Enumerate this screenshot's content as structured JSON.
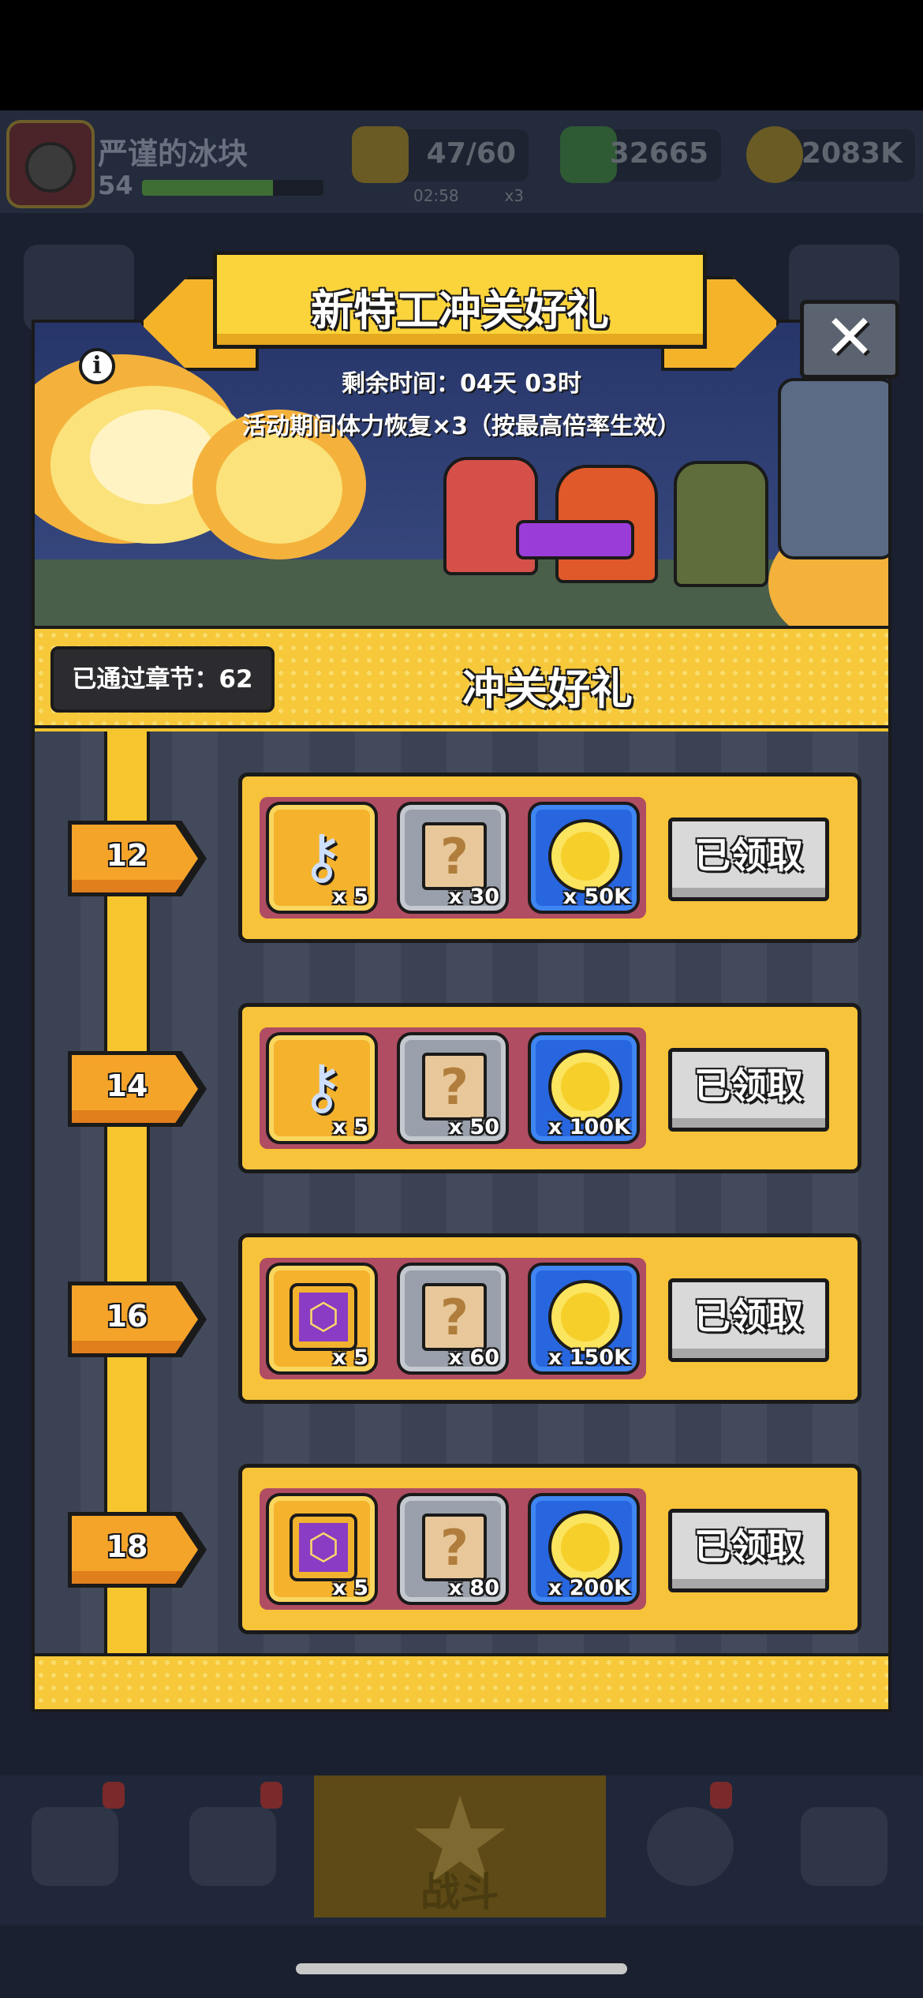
{
  "hud": {
    "player_name": "严谨的冰块",
    "player_level": "54",
    "xp_fraction": 0.72,
    "energy": "47/60",
    "energy_timer": "02:58",
    "energy_multiplier": "x3",
    "gems": "32665",
    "gold": "2083K"
  },
  "modal": {
    "title": "新特工冲关好礼",
    "close_icon": "close-icon",
    "info_icon": "info-icon",
    "remaining_time": "剩余时间：04天 03时",
    "bonus_note": "活动期间体力恢复×3（按最高倍率生效）",
    "chapters_passed": "已通过章节：62",
    "section_title": "冲关好礼"
  },
  "rewards": [
    {
      "milestone": "12",
      "items": [
        {
          "icon": "key-icon",
          "qty": "x 5"
        },
        {
          "icon": "mystery-scroll-icon",
          "qty": "x 30"
        },
        {
          "icon": "gold-coin-icon",
          "qty": "x 50K"
        }
      ],
      "button": "已领取"
    },
    {
      "milestone": "14",
      "items": [
        {
          "icon": "key-icon",
          "qty": "x 5"
        },
        {
          "icon": "mystery-scroll-icon",
          "qty": "x 50"
        },
        {
          "icon": "gold-coin-icon",
          "qty": "x 100K"
        }
      ],
      "button": "已领取"
    },
    {
      "milestone": "16",
      "items": [
        {
          "icon": "purple-chest-icon",
          "qty": "x 5"
        },
        {
          "icon": "mystery-scroll-icon",
          "qty": "x 60"
        },
        {
          "icon": "gold-coin-icon",
          "qty": "x 150K"
        }
      ],
      "button": "已领取"
    },
    {
      "milestone": "18",
      "items": [
        {
          "icon": "purple-chest-icon",
          "qty": "x 5"
        },
        {
          "icon": "mystery-scroll-icon",
          "qty": "x 80"
        },
        {
          "icon": "gold-coin-icon",
          "qty": "x 200K"
        }
      ],
      "button": "已领取"
    }
  ],
  "bottom_nav": {
    "battle_label": "战斗",
    "items": [
      "shop-icon",
      "badge-icon",
      "battle-icon",
      "stars-orb-icon",
      "scroll-tab-icon"
    ]
  },
  "colors": {
    "panel_yellow": "#f2c530",
    "slot_gold": "#f5b22d",
    "slot_gray": "#9aa0ab",
    "slot_blue": "#2866e0",
    "tray_red": "#b04d62",
    "claimed_gray": "#d9d9d9"
  }
}
